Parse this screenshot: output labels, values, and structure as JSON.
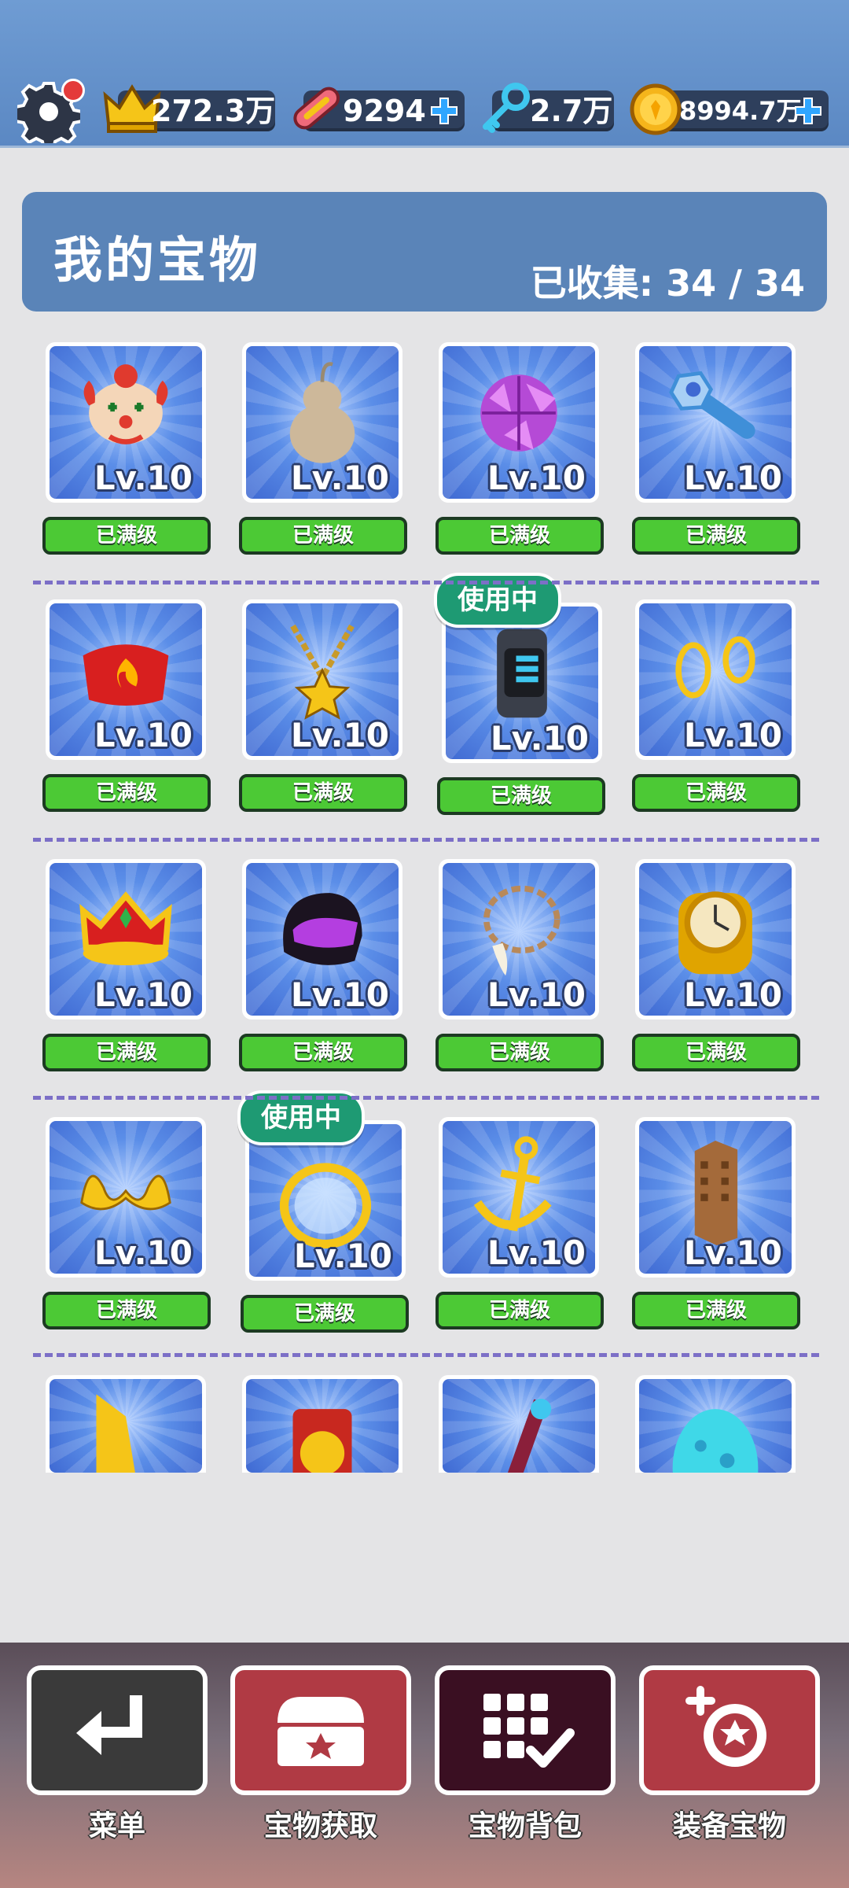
{
  "resources": {
    "crowns": "272.3万",
    "boards": "9294",
    "keys": "2.7万",
    "coins": "8994.7万"
  },
  "panel": {
    "title": "我的宝物",
    "collected_label": "已收集:",
    "collected_value": "34 / 34"
  },
  "items": [
    {
      "name": "clown-mask",
      "level": "Lv.10",
      "button": "已满级"
    },
    {
      "name": "gourd",
      "level": "Lv.10",
      "button": "已满级"
    },
    {
      "name": "purple-crystal-ball",
      "level": "Lv.10",
      "button": "已满级"
    },
    {
      "name": "blue-wrench",
      "level": "Lv.10",
      "button": "已满级"
    },
    {
      "name": "fire-hat",
      "level": "Lv.10",
      "button": "已满级"
    },
    {
      "name": "star-necklace",
      "level": "Lv.10",
      "button": "已满级"
    },
    {
      "name": "smart-watch",
      "level": "Lv.10",
      "button": "已满级",
      "badge": "使用中"
    },
    {
      "name": "gold-earrings",
      "level": "Lv.10",
      "button": "已满级"
    },
    {
      "name": "gold-crown",
      "level": "Lv.10",
      "button": "已满级"
    },
    {
      "name": "purple-helmet",
      "level": "Lv.10",
      "button": "已满级"
    },
    {
      "name": "tooth-necklace",
      "level": "Lv.10",
      "button": "已满级"
    },
    {
      "name": "gold-watch",
      "level": "Lv.10",
      "button": "已满级"
    },
    {
      "name": "gold-mustache",
      "level": "Lv.10",
      "button": "已满级"
    },
    {
      "name": "gold-ring",
      "level": "Lv.10",
      "button": "已满级",
      "badge": "使用中"
    },
    {
      "name": "gold-anchor",
      "level": "Lv.10",
      "button": "已满级"
    },
    {
      "name": "skyscraper",
      "level": "Lv.10",
      "button": "已满级"
    },
    {
      "name": "gold-horn",
      "level": "",
      "button": ""
    },
    {
      "name": "red-idol",
      "level": "",
      "button": ""
    },
    {
      "name": "red-staff",
      "level": "",
      "button": ""
    },
    {
      "name": "cyan-egg",
      "level": "",
      "button": ""
    }
  ],
  "nav": [
    {
      "label": "菜单",
      "icon": "return-arrow-icon",
      "color": "#3a3a3a"
    },
    {
      "label": "宝物获取",
      "icon": "treasure-chest-icon",
      "color": "#b03a44"
    },
    {
      "label": "宝物背包",
      "icon": "grid-check-icon",
      "color": "#3a0f22"
    },
    {
      "label": "装备宝物",
      "icon": "equip-treasure-icon",
      "color": "#b03a44"
    }
  ],
  "colors": {
    "topbar": "#5b88c3",
    "panel": "#5a84b8",
    "max_button": "#4cc935",
    "in_use_badge": "#1e9a73"
  }
}
